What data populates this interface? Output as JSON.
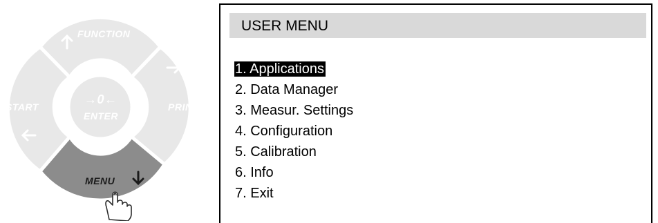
{
  "keypad": {
    "function_label": "FUNCTION",
    "start_label": "START",
    "print_label": "PRINT",
    "enter_label": "ENTER",
    "enter_symbol": "→0←",
    "menu_label": "MENU",
    "colors": {
      "idle_key": "#e8e8e8",
      "active_key": "#8c8c8c",
      "key_text": "#ffffff"
    },
    "icons": [
      "up-arrow-icon",
      "right-arrow-icon",
      "left-arrow-icon",
      "down-arrow-icon",
      "pointing-hand-icon"
    ]
  },
  "screen": {
    "title": "USER MENU",
    "selected_index": 0,
    "items": [
      {
        "label": "1. Applications"
      },
      {
        "label": "2. Data Manager"
      },
      {
        "label": "3. Measur. Settings"
      },
      {
        "label": "4. Configuration"
      },
      {
        "label": "5. Calibration"
      },
      {
        "label": "6. Info"
      },
      {
        "label": "7. Exit"
      }
    ],
    "colors": {
      "title_bar": "#d9d9d9",
      "highlight_bg": "#000000",
      "highlight_text": "#ffffff"
    }
  }
}
